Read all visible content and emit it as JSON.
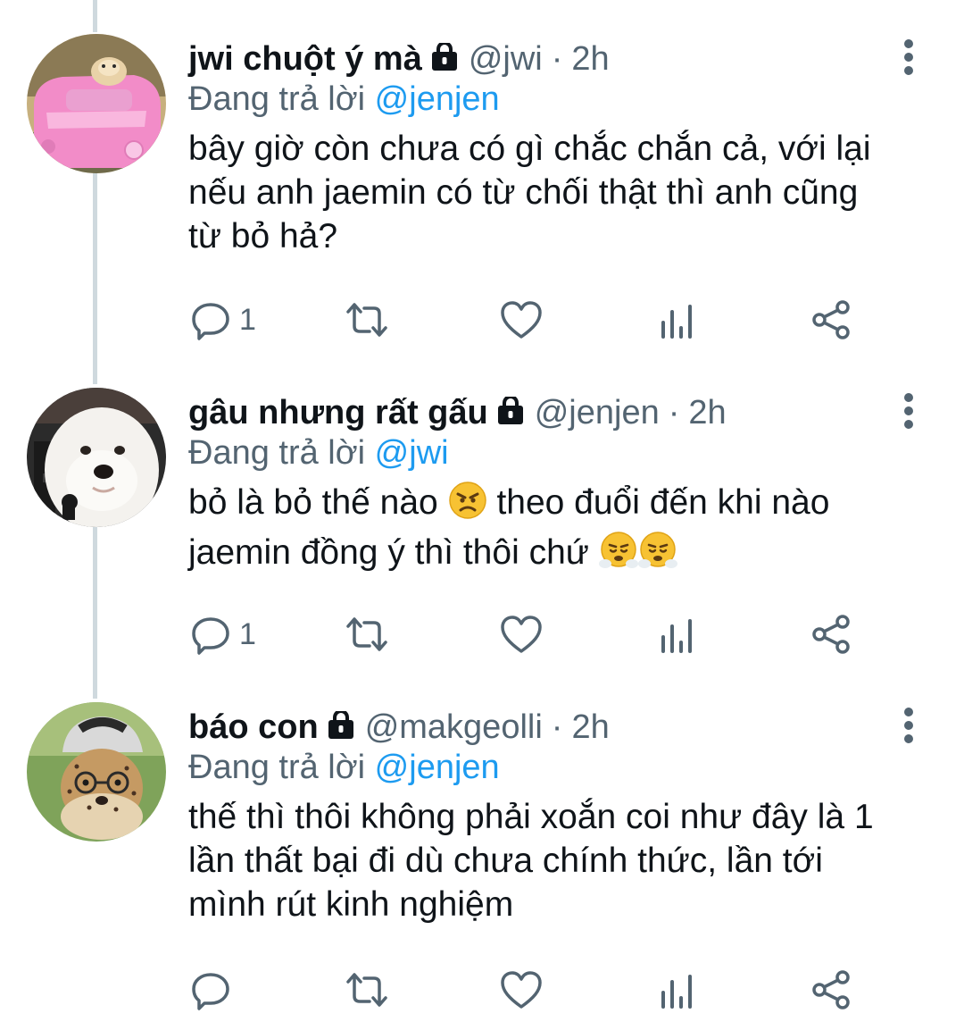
{
  "icons": {
    "reply": "reply-icon",
    "retweet": "retweet-icon",
    "like": "heart-icon",
    "views": "views-icon",
    "share": "share-icon",
    "more": "more-vertical-icon",
    "lock": "lock-icon"
  },
  "colors": {
    "text": "#0f1419",
    "secondary": "#536471",
    "link": "#1d9bf0",
    "thread_line": "#cfd9de"
  },
  "tweets": [
    {
      "name": "jwi chuột ý mà",
      "handle": "@jwi",
      "separator": "·",
      "time": "2h",
      "reply_prefix": "Đang trả lời",
      "reply_to": "@jenjen",
      "text_lines": [
        "bây giờ còn chưa có gì chắc chắn cả, với lại",
        "nếu anh jaemin có từ chối thật thì anh cũng",
        "từ bỏ hả?"
      ],
      "reply_count": "1",
      "avatar": "pink-toy-car-hamster-avatar"
    },
    {
      "name": "gâu nhưng rất gấu",
      "handle": "@jenjen",
      "separator": "·",
      "time": "2h",
      "reply_prefix": "Đang trả lời",
      "reply_to": "@jwi",
      "text_part1": "bỏ là bỏ thế nào",
      "text_part2": "theo đuổi đến khi nào",
      "text_line2": "jaemin đồng ý thì thôi chứ",
      "emojis": [
        "angry-face-emoji",
        "face-with-steam-emoji",
        "face-with-steam-emoji"
      ],
      "reply_count": "1",
      "avatar": "white-dog-avatar"
    },
    {
      "name": "báo con",
      "handle": "@makgeolli",
      "separator": "·",
      "time": "2h",
      "reply_prefix": "Đang trả lời",
      "reply_to": "@jenjen",
      "text_lines": [
        "thế thì thôi không phải xoắn coi như đây là 1",
        "lần thất bại đi dù chưa chính thức, lần tới",
        "mình rút kinh nghiệm"
      ],
      "reply_count": "",
      "avatar": "cheetah-cub-cap-avatar"
    }
  ]
}
